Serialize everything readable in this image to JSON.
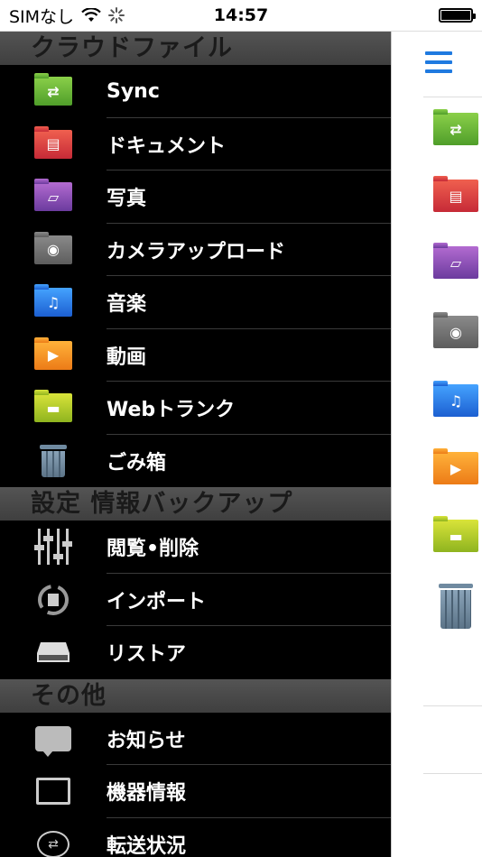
{
  "status_bar": {
    "carrier": "SIMなし",
    "time": "14:57"
  },
  "menu": {
    "sections": [
      {
        "title": "クラウドファイル",
        "items": [
          {
            "label": "Sync",
            "icon": "sync-folder-icon",
            "color": "#5fb236"
          },
          {
            "label": "ドキュメント",
            "icon": "document-folder-icon",
            "color": "#e0444a"
          },
          {
            "label": "写真",
            "icon": "photo-folder-icon",
            "color": "#8e4fb8"
          },
          {
            "label": "カメラアップロード",
            "icon": "camera-folder-icon",
            "color": "#707070"
          },
          {
            "label": "音楽",
            "icon": "music-folder-icon",
            "color": "#2f7ff0"
          },
          {
            "label": "動画",
            "icon": "video-folder-icon",
            "color": "#f5941f"
          },
          {
            "label": "Webトランク",
            "icon": "webtrunk-folder-icon",
            "color": "#b7cc2a"
          },
          {
            "label": "ごみ箱",
            "icon": "trash-icon",
            "color": "#6f8aa0"
          }
        ]
      },
      {
        "title": "設定 情報バックアップ",
        "items": [
          {
            "label": "閲覧•削除",
            "icon": "sliders-icon"
          },
          {
            "label": "インポート",
            "icon": "import-icon"
          },
          {
            "label": "リストア",
            "icon": "drive-icon"
          }
        ]
      },
      {
        "title": "その他",
        "items": [
          {
            "label": "お知らせ",
            "icon": "message-icon"
          },
          {
            "label": "機器情報",
            "icon": "monitor-icon"
          },
          {
            "label": "転送状況",
            "icon": "transfer-icon"
          }
        ]
      }
    ]
  },
  "right_panel": {
    "menu_icon": "hamburger-icon",
    "accent": "#1f7ae0"
  }
}
